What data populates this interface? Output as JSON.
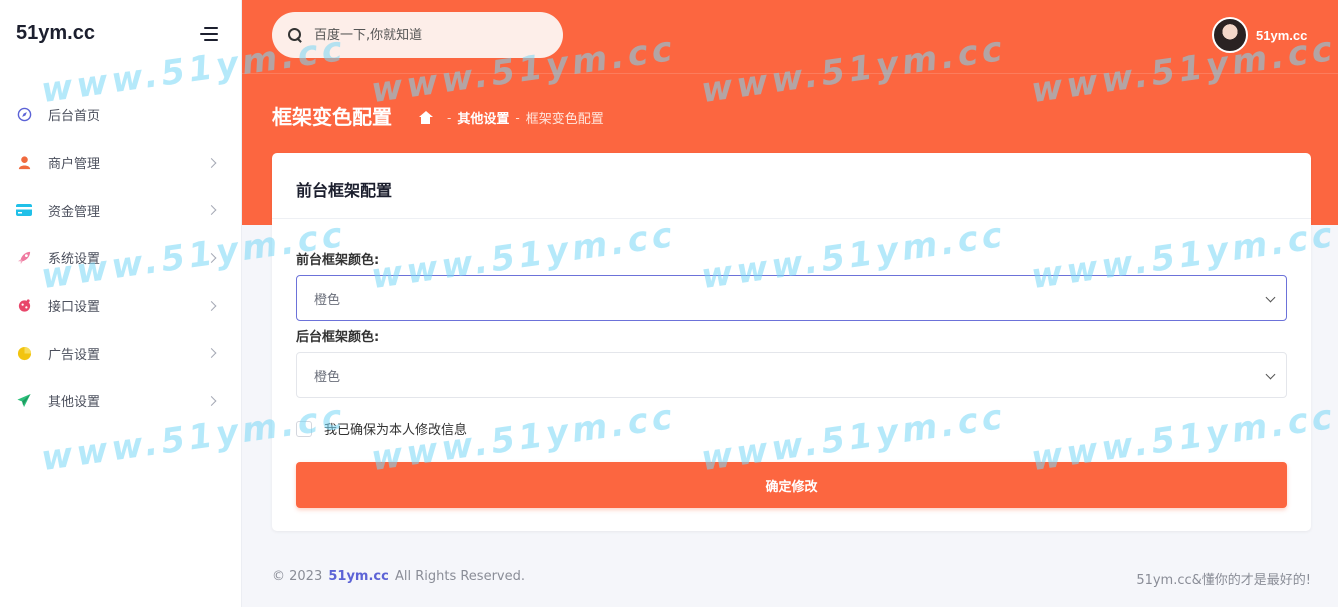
{
  "sidebar": {
    "brand": "51ym.cc",
    "items": [
      {
        "label": "后台首页",
        "icon": "compass-icon",
        "color": "#5b62d6",
        "has_arrow": false
      },
      {
        "label": "商户管理",
        "icon": "user-icon",
        "color": "#f06a3e",
        "has_arrow": true
      },
      {
        "label": "资金管理",
        "icon": "card-icon",
        "color": "#20c0e8",
        "has_arrow": true
      },
      {
        "label": "系统设置",
        "icon": "rocket-icon",
        "color": "#ef7aa0",
        "has_arrow": true
      },
      {
        "label": "接口设置",
        "icon": "bug-icon",
        "color": "#e8466a",
        "has_arrow": true
      },
      {
        "label": "广告设置",
        "icon": "pie-icon",
        "color": "#f2c40f",
        "has_arrow": true
      },
      {
        "label": "其他设置",
        "icon": "send-icon",
        "color": "#2cc07b",
        "has_arrow": true
      }
    ]
  },
  "header": {
    "search_placeholder": "百度一下,你就知道",
    "user_name": "51ym.cc",
    "page_title": "框架变色配置",
    "breadcrumb": {
      "sep": "-",
      "parent": "其他设置",
      "current": "框架变色配置"
    }
  },
  "card": {
    "title": "前台框架配置",
    "front_label": "前台框架颜色:",
    "front_value": "橙色",
    "back_label": "后台框架颜色:",
    "back_value": "橙色",
    "confirm_label": "我已确保为本人修改信息",
    "submit_label": "确定修改"
  },
  "footer": {
    "copyright_prefix": "© 2023",
    "brand_link": "51ym.cc",
    "copyright_suffix": "All Rights Reserved.",
    "slogan": "51ym.cc&懂你的才是最好的!"
  },
  "watermark": {
    "text": "www.51ym.cc"
  },
  "colors": {
    "accent": "#fc6640",
    "link": "#5c63d6"
  }
}
